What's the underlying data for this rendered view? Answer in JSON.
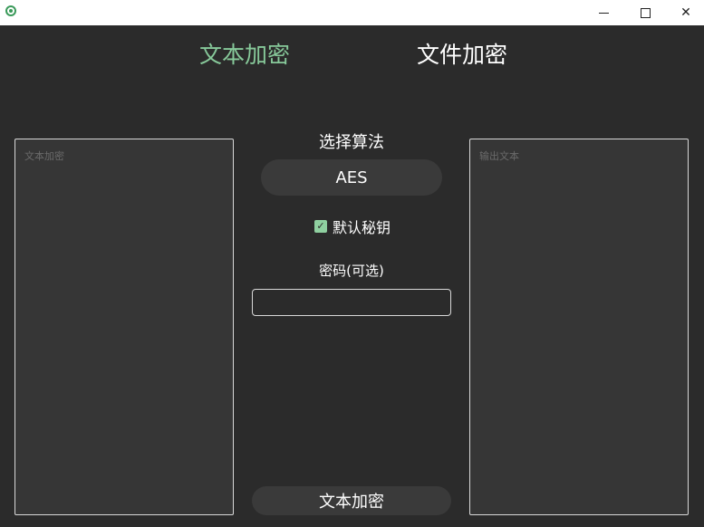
{
  "titlebar": {
    "icons": {
      "app": "app-icon",
      "minimize": "minimize-icon",
      "maximize": "maximize-icon",
      "close": "close-icon"
    },
    "close_glyph": "✕"
  },
  "tabs": [
    {
      "label": "文本加密",
      "active": true
    },
    {
      "label": "文件加密",
      "active": false
    }
  ],
  "input_panel": {
    "placeholder": "文本加密"
  },
  "output_panel": {
    "placeholder": "输出文本"
  },
  "controls": {
    "algorithm_label": "选择算法",
    "algorithm_value": "AES",
    "default_key_label": "默认秘钥",
    "default_key_checked": true,
    "check_glyph": "✓",
    "password_label": "密码(可选)",
    "password_value": "",
    "action_button": "文本加密"
  },
  "colors": {
    "background": "#2b2b2b",
    "accent": "#87c99a",
    "panel": "#363636",
    "pill": "#3a3a3a"
  }
}
